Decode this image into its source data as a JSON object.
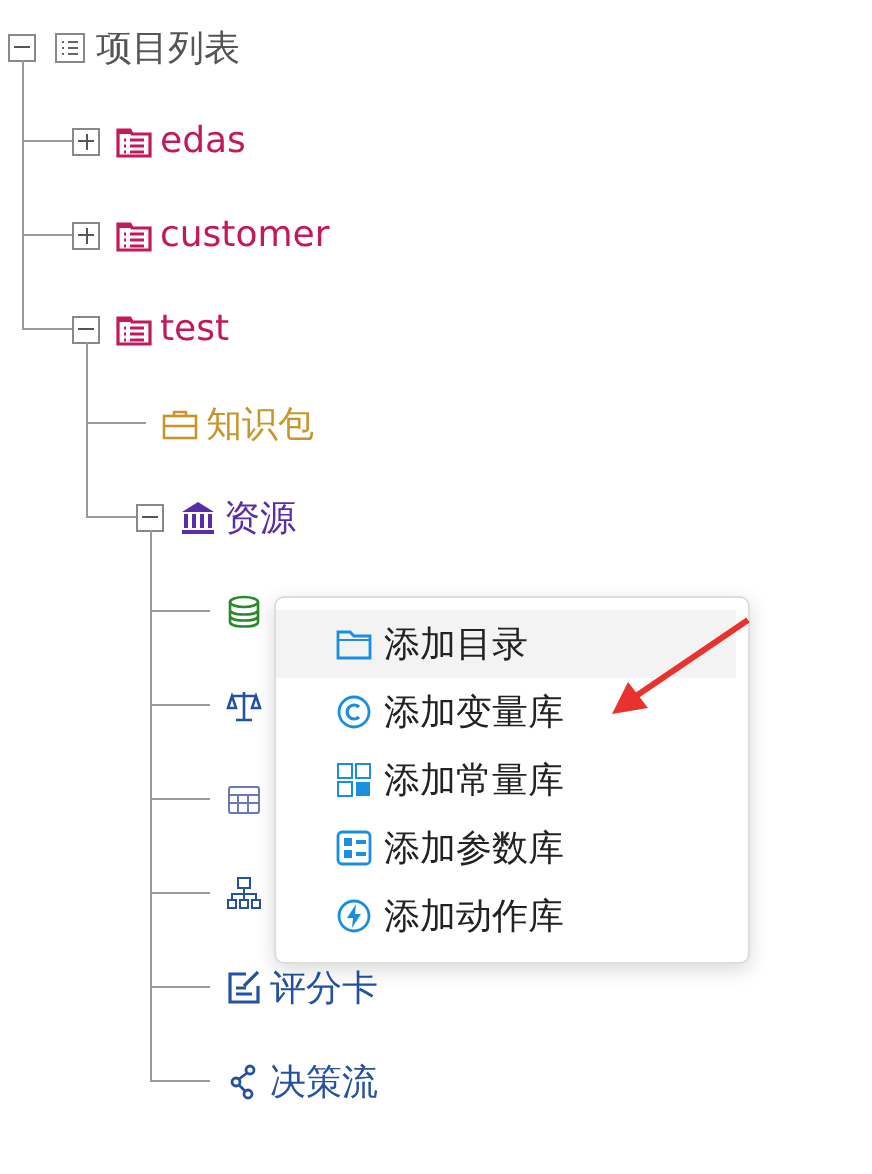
{
  "tree": {
    "kind": "root",
    "label": "项目列表",
    "expanded": true,
    "children": [
      {
        "kind": "project",
        "label": "edas",
        "expanded": false
      },
      {
        "kind": "project",
        "label": "customer",
        "expanded": false
      },
      {
        "kind": "project",
        "label": "test",
        "expanded": true,
        "children": [
          {
            "kind": "package",
            "label": "知识包"
          },
          {
            "kind": "resource",
            "label": "资源",
            "expanded": true,
            "children": [
              {
                "kind": "library"
              },
              {
                "kind": "rule"
              },
              {
                "kind": "table"
              },
              {
                "kind": "tree"
              },
              {
                "kind": "scorecard",
                "label": "评分卡"
              },
              {
                "kind": "flow",
                "label": "决策流"
              }
            ]
          }
        ]
      }
    ]
  },
  "context_menu": [
    {
      "kind": "folder",
      "label": "添加目录",
      "selected": true
    },
    {
      "kind": "variable",
      "label": "添加变量库",
      "selected": false
    },
    {
      "kind": "constant",
      "label": "添加常量库",
      "selected": false
    },
    {
      "kind": "parameter",
      "label": "添加参数库",
      "selected": false
    },
    {
      "kind": "action",
      "label": "添加动作库",
      "selected": false
    }
  ]
}
